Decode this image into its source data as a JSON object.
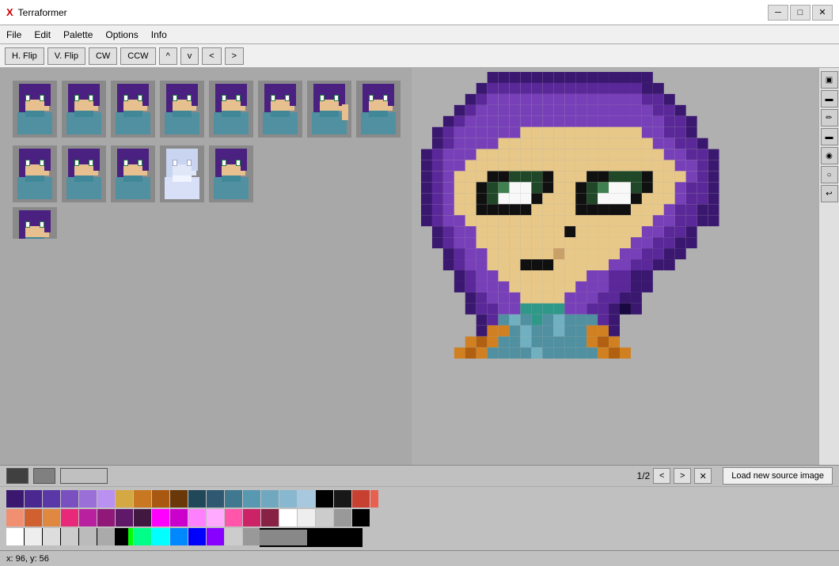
{
  "titlebar": {
    "icon": "X",
    "title": "Terraformer",
    "minimize_label": "─",
    "maximize_label": "□",
    "close_label": "✕"
  },
  "menubar": {
    "items": [
      "File",
      "Edit",
      "Palette",
      "Options",
      "Info"
    ]
  },
  "toolbar": {
    "buttons": [
      "H. Flip",
      "V. Flip",
      "CW",
      "CCW",
      "^",
      "v",
      "<",
      ">"
    ]
  },
  "right_toolbar": {
    "tools": [
      "▣",
      "▬",
      "✏",
      "▬",
      "◉",
      "○",
      "↩"
    ]
  },
  "pagination": {
    "current": "1/2",
    "prev": "<",
    "next": ">",
    "close": "✕"
  },
  "bottom": {
    "swatches": [
      "#404040",
      "#808080",
      "#c0c0c0"
    ],
    "load_source_label": "Load new source image",
    "palette_row1": [
      "#5c3d8a",
      "#8b5db5",
      "#b07dd4",
      "#d4a843",
      "#c87820",
      "#8c5a18",
      "#3a8060",
      "#205050",
      "#103828",
      "#204858",
      "#406878",
      "#588898",
      "#78a8b0",
      "#000000",
      "#202020",
      "#a03028",
      "#c84030",
      "#e86050",
      "#f09070",
      "#d06030",
      "#e08840"
    ],
    "palette_row2": [
      "#e82878",
      "#b820a0",
      "#901878",
      "#601868",
      "#401840",
      "#ff00ff",
      "#cc00cc",
      "#ff80ff",
      "#ffaaff",
      "#ff55aa",
      "#cc2266",
      "#882244",
      "#ffffff",
      "#eeeeee",
      "#cccccc",
      "#999999",
      "#666666",
      "#333333",
      "#111111",
      "#000000",
      "#223344"
    ],
    "palette_row3": [
      "#ff0000",
      "#ff4400",
      "#ff8800",
      "#ffcc00",
      "#ffff00",
      "#88ff00",
      "#00ff00",
      "#00ff88",
      "#00ffff",
      "#0088ff",
      "#0000ff",
      "#8800ff",
      "#cccccc",
      "#999999",
      "#666666",
      "#000000"
    ],
    "palette_row4": [
      "#ffffff",
      "#eeeeff",
      "#ccccff",
      "#aaaaff",
      "#8888ff",
      "#6666ff",
      "#4444ff",
      "#2222ff",
      "#0000ff",
      "#000000",
      "#111111",
      "#222222",
      "#333333",
      "#444444"
    ]
  },
  "status": {
    "coords": "x: 96, y: 56"
  },
  "pixel_art": {
    "description": "Anime character face with purple hair, pixel art style"
  }
}
